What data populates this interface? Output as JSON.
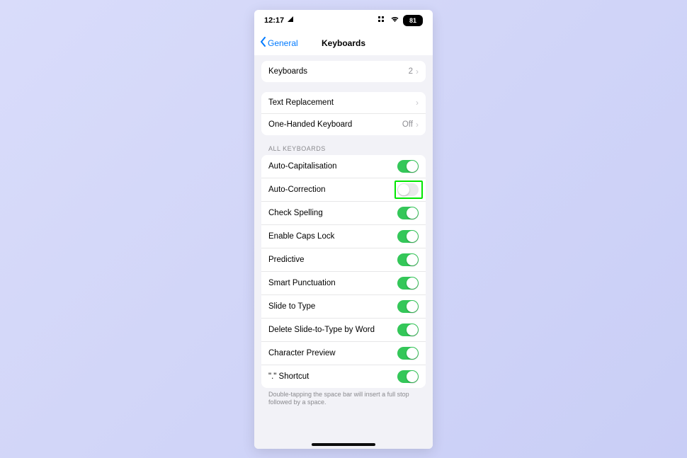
{
  "statusbar": {
    "time": "12:17",
    "location_glyph": "◪",
    "focus_glyph": "::",
    "wifi_glyph": "wifi",
    "battery_text": "81"
  },
  "nav": {
    "back_label": "General",
    "title": "Keyboards"
  },
  "sections": {
    "keyboards_row": {
      "label": "Keyboards",
      "value": "2"
    },
    "text_replacement": {
      "label": "Text Replacement"
    },
    "one_handed": {
      "label": "One-Handed Keyboard",
      "value": "Off"
    },
    "all_keyboards_header": "All Keyboards",
    "toggles": [
      {
        "name": "auto-capitalisation",
        "label": "Auto-Capitalisation",
        "on": true,
        "highlight": false
      },
      {
        "name": "auto-correction",
        "label": "Auto-Correction",
        "on": false,
        "highlight": true
      },
      {
        "name": "check-spelling",
        "label": "Check Spelling",
        "on": true,
        "highlight": false
      },
      {
        "name": "enable-caps-lock",
        "label": "Enable Caps Lock",
        "on": true,
        "highlight": false
      },
      {
        "name": "predictive",
        "label": "Predictive",
        "on": true,
        "highlight": false
      },
      {
        "name": "smart-punctuation",
        "label": "Smart Punctuation",
        "on": true,
        "highlight": false
      },
      {
        "name": "slide-to-type",
        "label": "Slide to Type",
        "on": true,
        "highlight": false
      },
      {
        "name": "delete-slide-word",
        "label": "Delete Slide-to-Type by Word",
        "on": true,
        "highlight": false
      },
      {
        "name": "character-preview",
        "label": "Character Preview",
        "on": true,
        "highlight": false
      },
      {
        "name": "period-shortcut",
        "label": "\".\" Shortcut",
        "on": true,
        "highlight": false
      }
    ],
    "footer": "Double-tapping the space bar will insert a full stop followed by a space."
  },
  "colors": {
    "accent_blue": "#007aff",
    "toggle_green": "#34c759",
    "highlight_green": "#00e600"
  }
}
